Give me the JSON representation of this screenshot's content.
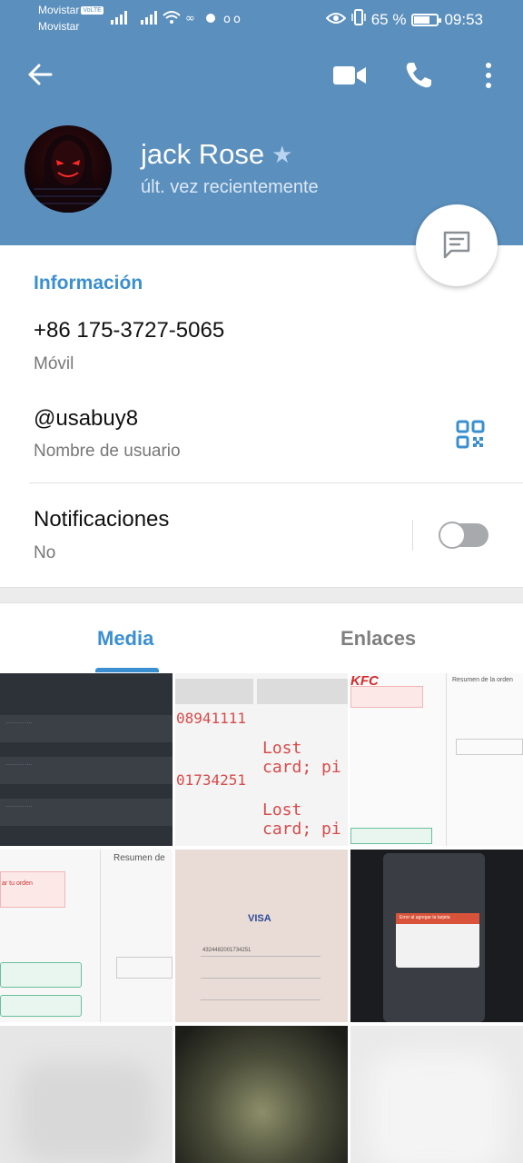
{
  "status_bar": {
    "carrier_primary": "Movistar",
    "carrier_badge": "VoLTE",
    "carrier_secondary": "Movistar",
    "battery_percent": "65 %",
    "battery_level": 0.65,
    "time": "09:53"
  },
  "header": {
    "name": "jack Rose",
    "last_seen": "últ. vez recientemente",
    "background_color": "#5b8fbd"
  },
  "info": {
    "section_title": "Información",
    "phone": "+86 175-3727-5065",
    "phone_label": "Móvil",
    "username": "@usabuy8",
    "username_label": "Nombre de usuario",
    "notifications_label": "Notificaciones",
    "notifications_value": "No",
    "notifications_enabled": false
  },
  "tabs": {
    "media": "Media",
    "links": "Enlaces",
    "active": "media"
  },
  "media": {
    "thumb2": {
      "number_a": "08941111",
      "number_b": "01734251",
      "caption_a": "Lost card; pi",
      "caption_b": "Lost card; pi"
    },
    "thumb3": {
      "brand": "KFC",
      "summary": "Resumen de la orden"
    },
    "thumb4": {
      "summary": "Resumen de",
      "alert": "ar tu orden"
    },
    "thumb5": {
      "brand": "VISA",
      "number": "4324482001734251"
    },
    "thumb6": {
      "error": "Error al agregar la tarjeta"
    }
  },
  "colors": {
    "accent": "#3a8fd1",
    "header": "#5b8fbd",
    "alert_red": "#d84a4a"
  },
  "icons": {
    "back": "arrow-left-icon",
    "video": "video-camera-icon",
    "call": "phone-icon",
    "more": "more-vertical-icon",
    "star": "star-icon",
    "message": "message-icon",
    "qr": "qr-code-icon"
  }
}
